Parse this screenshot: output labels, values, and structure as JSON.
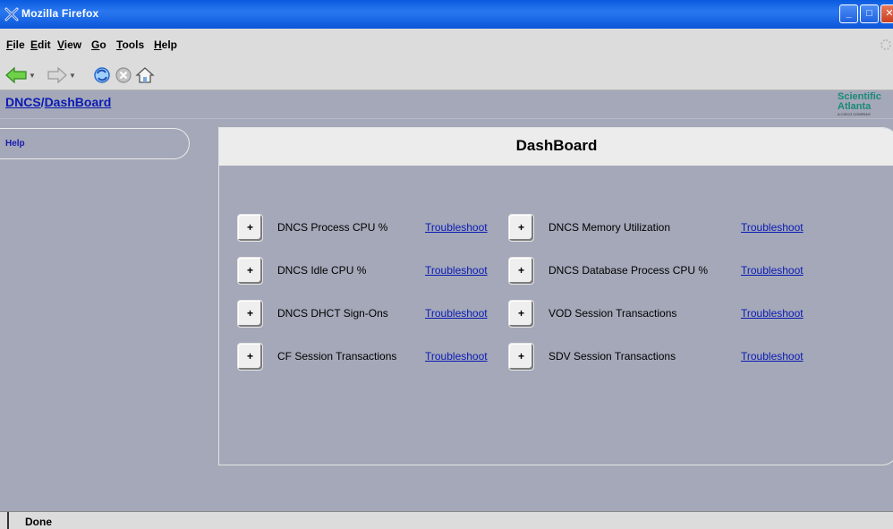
{
  "window": {
    "title": "Mozilla Firefox",
    "buttons": {
      "min": "_",
      "max": "□",
      "close": "✕"
    }
  },
  "menu": {
    "items": [
      "File",
      "Edit",
      "View",
      "Go",
      "Tools",
      "Help"
    ]
  },
  "toolbar": {
    "buttons": [
      "back-icon",
      "forward-icon",
      "reload-icon",
      "stop-icon",
      "home-icon"
    ]
  },
  "breadcrumb": {
    "root": "DNCS",
    "separator": "/",
    "current": "DashBoard"
  },
  "logo": {
    "line1": "Scientific",
    "line2": "Atlanta",
    "sub": "A CISCO COMPANY"
  },
  "sidebar": {
    "help_label": "Help"
  },
  "dashboard": {
    "title": "DashBoard",
    "expand_label": "+",
    "link_label": "Troubleshoot",
    "metrics_left": [
      "DNCS Process CPU %",
      "DNCS Idle CPU %",
      "DNCS DHCT Sign-Ons",
      "CF Session Transactions"
    ],
    "metrics_right": [
      "DNCS Memory Utilization",
      "DNCS Database Process CPU %",
      "VOD Session Transactions",
      "SDV Session Transactions"
    ]
  },
  "status": {
    "text": "Done"
  },
  "colors": {
    "titlebar": "#0a5adf",
    "page_bg": "#a4a8b8",
    "link": "#0a1ab4",
    "logo": "#1a8a78"
  }
}
